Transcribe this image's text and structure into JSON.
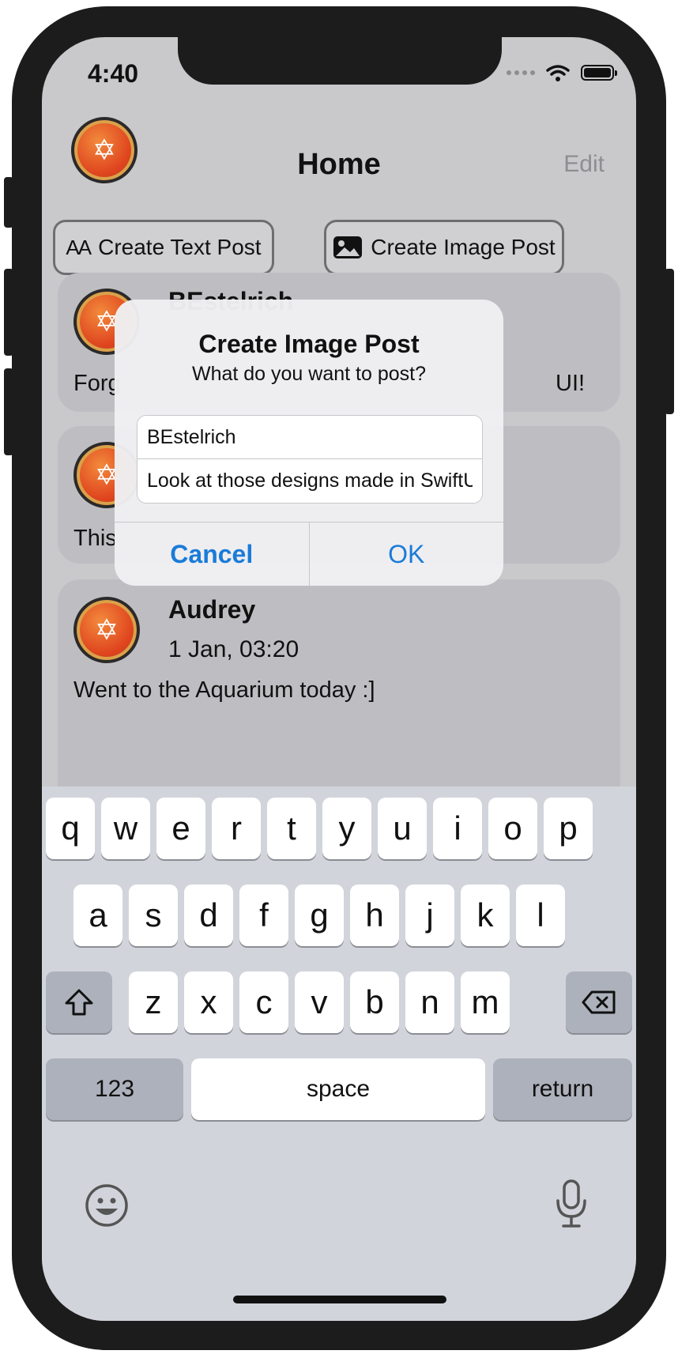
{
  "status": {
    "time": "4:40"
  },
  "nav": {
    "title": "Home",
    "edit": "Edit"
  },
  "actions": {
    "text_post": "Create Text Post",
    "image_post": "Create Image Post",
    "text_icon": "AA"
  },
  "feed": [
    {
      "user": "BEstelrich",
      "body_left": "Forg",
      "body_right": "UI!"
    },
    {
      "body_left": "This"
    },
    {
      "user": "Audrey",
      "date": "1 Jan, 03:20",
      "body": "Went to the Aquarium today :]"
    }
  ],
  "alert": {
    "title": "Create Image Post",
    "message": "What do you want to post?",
    "field_user": "BEstelrich",
    "field_body": "Look at those designs made in SwiftU",
    "cancel": "Cancel",
    "ok": "OK"
  },
  "keyboard": {
    "row1": [
      "q",
      "w",
      "e",
      "r",
      "t",
      "y",
      "u",
      "i",
      "o",
      "p"
    ],
    "row2": [
      "a",
      "s",
      "d",
      "f",
      "g",
      "h",
      "j",
      "k",
      "l"
    ],
    "row3": [
      "z",
      "x",
      "c",
      "v",
      "b",
      "n",
      "m"
    ],
    "numbers": "123",
    "space": "space",
    "return": "return"
  },
  "colors": {
    "accent": "#1a7bd9",
    "background": "#c9c9cb",
    "card": "#bebec2"
  }
}
